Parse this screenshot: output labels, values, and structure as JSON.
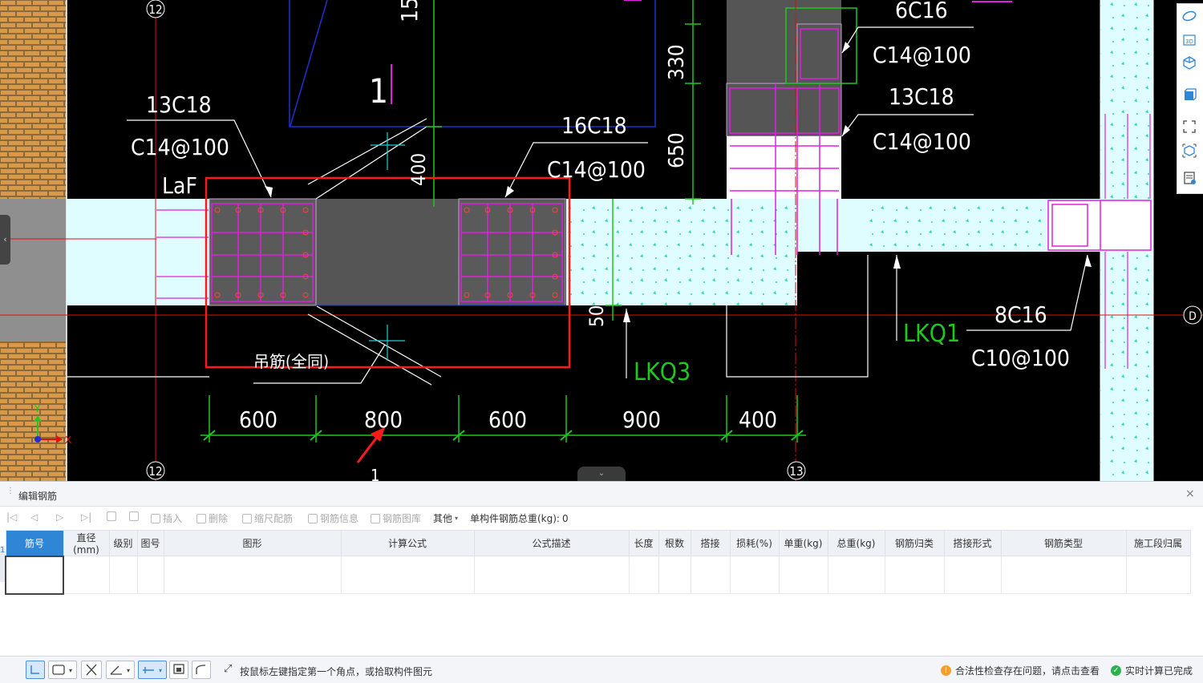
{
  "drawing": {
    "axis_labels": [
      "12",
      "12",
      "13",
      "D"
    ],
    "top_texts": [
      "15",
      "1",
      "13C18",
      "C14@100",
      "LaF",
      "16C18",
      "C14@100",
      "400",
      "330",
      "650",
      "6C16",
      "C14@100",
      "13C18",
      "C14@100"
    ],
    "bottom_texts": [
      "吊筋(全同)",
      "50",
      "LKQ3",
      "LKQ1",
      "8C16",
      "C10@100",
      "1"
    ],
    "dimensions": [
      "600",
      "800",
      "600",
      "900",
      "400"
    ],
    "coordinate_axes": {
      "x": "X",
      "y": "Y"
    }
  },
  "right_toolbar": {
    "icons": [
      "ellipse-icon",
      "3d-icon",
      "cube-icon",
      "box-icon",
      "fullscreen-icon",
      "view-cube-icon",
      "properties-icon"
    ],
    "label_3d": "3D"
  },
  "panel": {
    "title": "编辑钢筋",
    "close": "×",
    "toolbar": {
      "insert": "插入",
      "delete": "删除",
      "scale_rebar": "缩尺配筋",
      "rebar_info": "钢筋信息",
      "rebar_library": "钢筋图库",
      "other": "其他",
      "total_weight_label": "单构件钢筋总重(kg):",
      "total_weight_value": "0"
    },
    "columns": [
      "筋号",
      "直径(mm)",
      "级别",
      "图号",
      "图形",
      "计算公式",
      "公式描述",
      "长度",
      "根数",
      "搭接",
      "损耗(%)",
      "单重(kg)",
      "总重(kg)",
      "钢筋归类",
      "搭接形式",
      "钢筋类型",
      "施工段归属"
    ],
    "row_number": "1"
  },
  "statusbar": {
    "hint": "按鼠标左键指定第一个角点，或拾取构件图元",
    "warning": "合法性检查存在问题，请点击查看",
    "calc": "实时计算已完成"
  }
}
